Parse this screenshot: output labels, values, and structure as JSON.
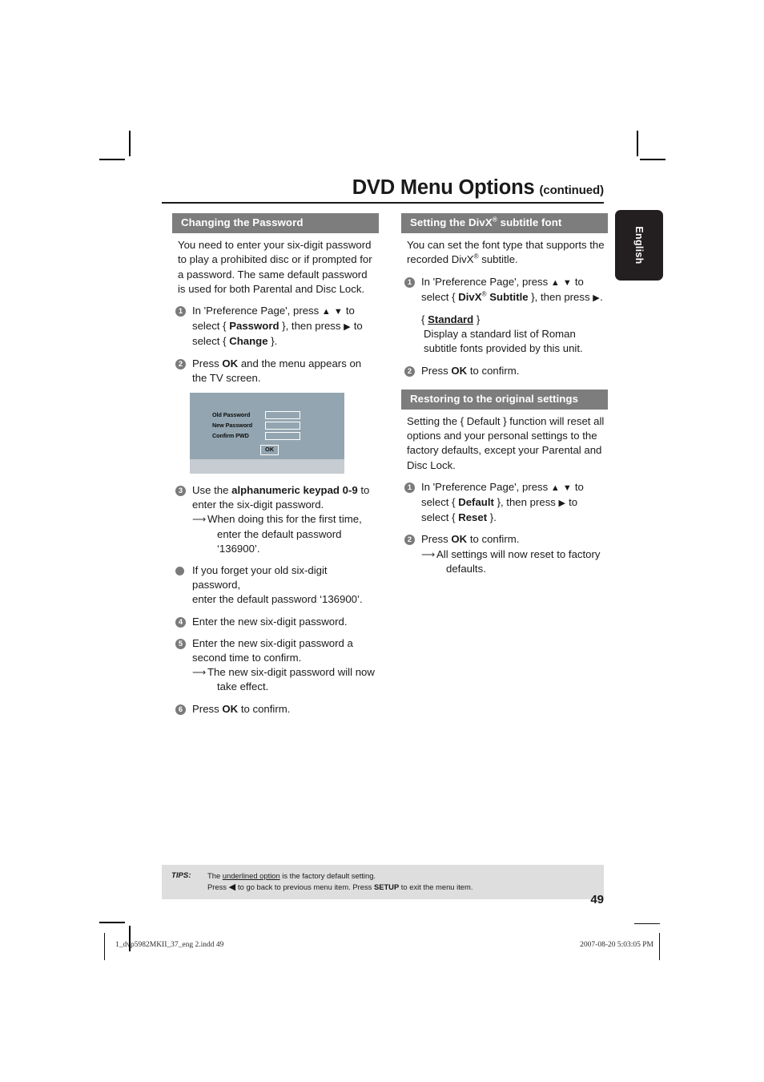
{
  "header": {
    "title": "DVD Menu Options",
    "subtitle": "(continued)"
  },
  "language_tab": {
    "label": "English"
  },
  "left_column": {
    "section_title": "Changing the Password",
    "intro": "You need to enter your six-digit password to play a prohibited disc or if prompted for a password. The same default password is used for both Parental and Disc Lock.",
    "steps": [
      {
        "num": "1",
        "text_parts": {
          "a": "In 'Preference Page', press ",
          "up": "▲",
          "down": "▼",
          "b": " to select",
          "c": "{ ",
          "bold1": "Password",
          "d": " }, then press ",
          "right": "▶",
          "e": " to select",
          "f": "{ ",
          "bold2": "Change",
          "g": " }."
        }
      },
      {
        "num": "2",
        "text_a": "Press ",
        "bold": "OK",
        "text_b": " and the menu appears on the TV screen."
      },
      {
        "num": "3",
        "text_a": "Use the ",
        "bold": "alphanumeric keypad 0-9",
        "text_b": " to enter the six-digit password.",
        "sub_line1": "When doing this for the first time,",
        "sub_line2": "enter the default password ‘136900’."
      },
      {
        "num": "4",
        "text": "Enter the new six-digit password."
      },
      {
        "num": "5",
        "text": "Enter the new six-digit password a second time to confirm.",
        "sub_line1": "The new six-digit password will now",
        "sub_line2": "take effect."
      },
      {
        "num": "6",
        "text_a": "Press ",
        "bold": "OK",
        "text_b": " to confirm."
      }
    ],
    "bullet": {
      "line1": "If you forget your old six-digit password,",
      "line2": "enter the default password ‘136900’."
    },
    "tv_screen": {
      "rows": [
        {
          "label": "Old  Password"
        },
        {
          "label": "New Password"
        },
        {
          "label": "Confirm PWD"
        }
      ],
      "ok_label": "OK"
    }
  },
  "right_column": {
    "section1": {
      "title_a": "Setting the DivX",
      "title_sup": "®",
      "title_b": " subtitle font",
      "intro_a": "You can set the font type that supports the recorded DivX",
      "intro_sup": "®",
      "intro_b": " subtitle.",
      "steps": [
        {
          "num": "1",
          "a": "In 'Preference Page', press ",
          "up": "▲",
          "down": "▼",
          "b": " to select",
          "c": "{ ",
          "bold1": "DivX",
          "sup": "®",
          "bold2": " Subtitle",
          "d": " }, then press ",
          "right": "▶",
          "e": "."
        },
        {
          "num": "2",
          "text_a": "Press ",
          "bold": "OK",
          "text_b": " to confirm."
        }
      ],
      "option": {
        "open": "{ ",
        "name": "Standard",
        "close": " }",
        "desc": "Display a standard list of Roman subtitle fonts provided by this unit."
      }
    },
    "section2": {
      "title": "Restoring to the original settings",
      "intro": "Setting the { Default } function will reset all options and your personal settings to the factory defaults, except your Parental and Disc Lock.",
      "steps": [
        {
          "num": "1",
          "a": "In 'Preference Page', press ",
          "up": "▲",
          "down": "▼",
          "b": " to select",
          "c": "{ ",
          "bold1": "Default",
          "d": " }, then press ",
          "right": "▶",
          "e": " to select",
          "f": "{ ",
          "bold2": "Reset",
          "g": " }."
        },
        {
          "num": "2",
          "text_a": "Press ",
          "bold": "OK",
          "text_b": " to confirm.",
          "sub_line1": "All settings will now reset to factory",
          "sub_line2": "defaults."
        }
      ]
    }
  },
  "tips": {
    "label": "TIPS:",
    "line1_a": "The ",
    "line1_underline": "underlined option",
    "line1_b": " is the factory default setting.",
    "line2_a": "Press ",
    "line2_arrow": "◀",
    "line2_b": " to go back to previous menu item. Press ",
    "line2_bold": "SETUP",
    "line2_c": " to exit the menu item."
  },
  "page_number": "49",
  "print_footer": {
    "file": "1_dvp5982MKII_37_eng 2.indd   49",
    "timestamp": "2007-08-20   5:03:05 PM"
  }
}
